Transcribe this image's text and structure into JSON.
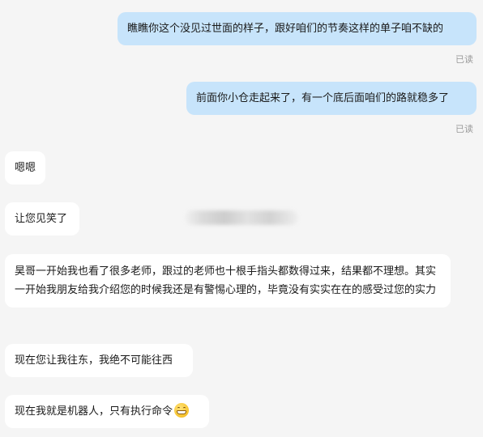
{
  "messages": [
    {
      "direction": "out",
      "text": "瞧瞧你这个没见过世面的样子，跟好咱们的节奏这样的单子咱不缺的",
      "status": "已读"
    },
    {
      "direction": "out",
      "text": "前面你小仓走起来了，有一个底后面咱们的路就稳多了",
      "status": "已读"
    },
    {
      "direction": "in",
      "text": "嗯嗯"
    },
    {
      "direction": "in",
      "text": "让您见笑了"
    },
    {
      "direction": "in",
      "text": "昊哥一开始我也看了很多老师，跟过的老师也十根手指头都数得过来，结果都不理想。其实一开始我朋友给我介绍您的时候我还是有警惕心理的，毕竟没有实实在在的感受过您的实力"
    },
    {
      "direction": "in",
      "text": "现在您让我往东，我绝不可能往西"
    },
    {
      "direction": "in",
      "text": "现在我就是机器人，只有执行命令",
      "emoji": "grinning-face-icon"
    }
  ],
  "colors": {
    "background": "#f5f5f5",
    "outgoing_bubble": "#c7e4fb",
    "incoming_bubble": "#ffffff",
    "read_status": "#9a9a9a"
  }
}
